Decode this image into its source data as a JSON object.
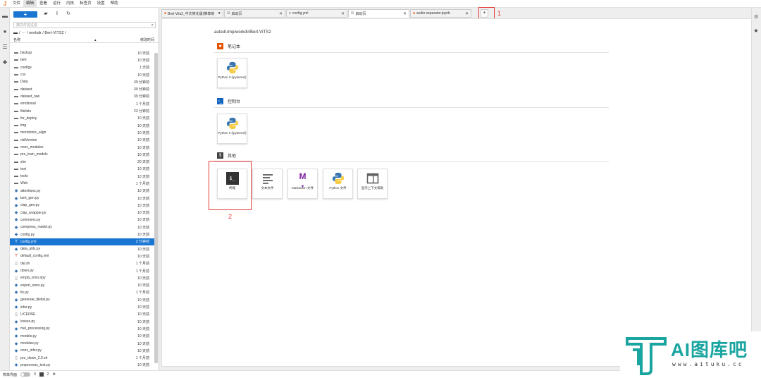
{
  "menubar": {
    "items": [
      "文件",
      "编辑",
      "查看",
      "运行",
      "内核",
      "标签页",
      "设置",
      "帮助"
    ],
    "active_index": 1
  },
  "browser": {
    "new_label": "+",
    "filter_placeholder": "按文件名过滤",
    "breadcrumb": [
      "/",
      "···",
      "/ workdir / Bert-VITS2 /"
    ],
    "col_name": "名称",
    "col_modified": "修改时间",
    "files": [
      {
        "name": "backup",
        "mod": "10 天前",
        "type": "folder"
      },
      {
        "name": "bert",
        "mod": "10 天前",
        "type": "folder"
      },
      {
        "name": "configs",
        "mod": "1 天前",
        "type": "folder"
      },
      {
        "name": "css",
        "mod": "10 天前",
        "type": "folder"
      },
      {
        "name": "Data",
        "mod": "39 分钟前",
        "type": "folder"
      },
      {
        "name": "dataset",
        "mod": "39 分钟前",
        "type": "folder"
      },
      {
        "name": "dataset_raw",
        "mod": "39 分钟前",
        "type": "folder"
      },
      {
        "name": "emotional",
        "mod": "1 个月前",
        "type": "folder"
      },
      {
        "name": "filelists",
        "mod": "23 分钟前",
        "type": "folder"
      },
      {
        "name": "for_deploy",
        "mod": "10 天前",
        "type": "folder"
      },
      {
        "name": "img",
        "mod": "10 天前",
        "type": "folder"
      },
      {
        "name": "monotonic_align",
        "mod": "10 天前",
        "type": "folder"
      },
      {
        "name": "oldVersion",
        "mod": "10 天前",
        "type": "folder"
      },
      {
        "name": "onnx_modules",
        "mod": "10 天前",
        "type": "folder"
      },
      {
        "name": "pre_train_models",
        "mod": "10 天前",
        "type": "folder"
      },
      {
        "name": "slm",
        "mod": "20 天前",
        "type": "folder"
      },
      {
        "name": "text",
        "mod": "10 天前",
        "type": "folder"
      },
      {
        "name": "tools",
        "mod": "10 天前",
        "type": "folder"
      },
      {
        "name": "Web",
        "mod": "1 个月前",
        "type": "folder"
      },
      {
        "name": "attentions.py",
        "mod": "10 天前",
        "type": "py"
      },
      {
        "name": "bert_gen.py",
        "mod": "10 天前",
        "type": "py"
      },
      {
        "name": "clap_gen.py",
        "mod": "10 天前",
        "type": "py"
      },
      {
        "name": "clap_wrapper.py",
        "mod": "10 天前",
        "type": "py"
      },
      {
        "name": "commons.py",
        "mod": "10 天前",
        "type": "py"
      },
      {
        "name": "compress_model.py",
        "mod": "10 天前",
        "type": "py"
      },
      {
        "name": "config.py",
        "mod": "10 天前",
        "type": "py"
      },
      {
        "name": "config.yml",
        "mod": "2 分钟前",
        "type": "yml",
        "selected": true
      },
      {
        "name": "data_utils.py",
        "mod": "10 天前",
        "type": "py"
      },
      {
        "name": "default_config.yml",
        "mod": "10 天前",
        "type": "yml"
      },
      {
        "name": "dal.sh",
        "mod": "1 个月前",
        "type": "file"
      },
      {
        "name": "down.py",
        "mod": "1 个月前",
        "type": "py"
      },
      {
        "name": "empty_emo.npy",
        "mod": "10 天前",
        "type": "file"
      },
      {
        "name": "export_onnx.py",
        "mod": "10 天前",
        "type": "py"
      },
      {
        "name": "fix.py",
        "mod": "1 个月前",
        "type": "py"
      },
      {
        "name": "generate_filelist.py",
        "mod": "10 天前",
        "type": "py"
      },
      {
        "name": "infer.py",
        "mod": "10 天前",
        "type": "py"
      },
      {
        "name": "LICENSE",
        "mod": "10 天前",
        "type": "file"
      },
      {
        "name": "losses.py",
        "mod": "10 天前",
        "type": "py"
      },
      {
        "name": "mel_processing.py",
        "mod": "10 天前",
        "type": "py"
      },
      {
        "name": "models.py",
        "mod": "10 天前",
        "type": "py"
      },
      {
        "name": "modules.py",
        "mod": "10 天前",
        "type": "py"
      },
      {
        "name": "onnx_infer.py",
        "mod": "10 天前",
        "type": "py"
      },
      {
        "name": "pre_down_2.0.sh",
        "mod": "1 个月前",
        "type": "file"
      },
      {
        "name": "preprocess_text.py",
        "mod": "10 天前",
        "type": "py"
      }
    ]
  },
  "tabs": [
    {
      "label": "Bert-Vits2_中文简化版(推荐练",
      "icon": "notebook",
      "close": "●",
      "width": 88
    },
    {
      "label": "启动页",
      "icon": "launcher",
      "close": "✕",
      "width": 87
    },
    {
      "label": "config.yml",
      "icon": "editor",
      "close": "✕",
      "width": 87
    },
    {
      "label": "启动页",
      "icon": "launcher",
      "close": "✕",
      "width": 87,
      "active": true
    },
    {
      "label": "audio separator.ipynb",
      "icon": "notebook",
      "close": "✕",
      "width": 87
    }
  ],
  "add_tab": "+",
  "annotations": {
    "one": "1",
    "two": "2"
  },
  "launcher": {
    "path": "autodl-tmp/workdir/Bert-VITS2",
    "sections": {
      "notebook": "笔记本",
      "console": "控制台",
      "other": "其他"
    },
    "notebook_card": "Python 3 (ipykernel)",
    "console_card": "Python 3 (ipykernel)",
    "other_cards": [
      "终端",
      "文本文件",
      "Markdown 文件",
      "Python 文件",
      "显示上下文帮助"
    ]
  },
  "statusbar": {
    "mode": "简单界面",
    "count1": "0",
    "count2": "2"
  },
  "watermark": {
    "brand": "AI图库吧",
    "url": "www.aituku.cc"
  },
  "colors": {
    "accent": "#1976d2",
    "annotation": "#e53935",
    "python_blue": "#3a75b0",
    "python_yellow": "#f7cc42",
    "notebook_orange": "#f37626",
    "watermark": "#1aa5a0"
  }
}
